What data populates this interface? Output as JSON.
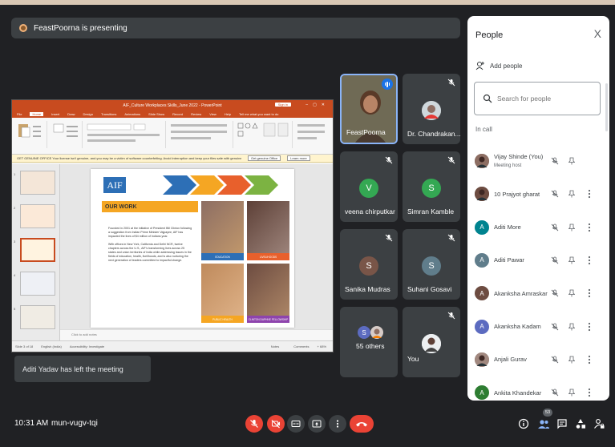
{
  "presenting_banner": "FeastPoorna is presenting",
  "shared_screen": {
    "title_bar": "AIF_Culture Workplaces Skills_June 2022 - PowerPoint",
    "sign_in": "Sign in",
    "menu": [
      "File",
      "Home",
      "Insert",
      "Draw",
      "Design",
      "Transitions",
      "Animations",
      "Slide Show",
      "Record",
      "Review",
      "View",
      "Help",
      "Tell me what you want to do"
    ],
    "warning": "GET GENUINE OFFICE  Your license isn't genuine, and you may be a victim of software counterfeiting. Avoid interruption and keep your files safe with genuine Office today.",
    "warning_btn1": "Get genuine Office",
    "warning_btn2": "Learn more",
    "slide": {
      "logo": "AIF",
      "heading": "OUR WORK",
      "para1": "Founded in 2001 at the initiative of President Bill Clinton following a suggestion from Indian Prime Minister Vajpayee, AIF has impacted the lives of $4 million of Indians year.",
      "para2": "With offices in New York, California and Delhi NCR, twelve chapters across the U.S., AIF's transforming lives across 25 states and union territories of India while addressing issues in the fields of education, health, livelihoods, and is also nurturing the next generation of leaders committed to impactful change.",
      "photo_captions": [
        "EDUCATION",
        "LIVELIHOODS",
        "PUBLIC HEALTH",
        "CLINTON DAPHNE FELLOWSHIP"
      ]
    },
    "notes": "Click to add notes",
    "status_left": "Slide 3 of 18",
    "status_lang": "English (India)",
    "status_access": "Accessibility: Investigate",
    "status_notes": "Notes",
    "status_comments": "Comments",
    "zoom": "+ 68%"
  },
  "toast": "Aditi Yadav has left the meeting",
  "tiles": [
    {
      "name": "FeastPoorna",
      "initial": "",
      "color": "",
      "muted": false
    },
    {
      "name": "Dr. Chandrakan...",
      "initial": "",
      "color": "",
      "muted": true
    },
    {
      "name": "veena chirputkar",
      "initial": "V",
      "color": "#34a853",
      "muted": true
    },
    {
      "name": "Simran Kamble",
      "initial": "S",
      "color": "#34a853",
      "muted": true
    },
    {
      "name": "Sanika Mudras",
      "initial": "S",
      "color": "#795548",
      "muted": true
    },
    {
      "name": "Suhani Gosavi",
      "initial": "S",
      "color": "#607d8b",
      "muted": true
    },
    {
      "name": "55 others",
      "initial": "S",
      "color": "#5c6bc0",
      "muted": false
    },
    {
      "name": "You",
      "initial": "",
      "color": "",
      "muted": true
    }
  ],
  "people_panel": {
    "title": "People",
    "close": "X",
    "add_people": "Add people",
    "search_placeholder": "Search for people",
    "in_call": "In call",
    "participants": [
      {
        "name": "Vijay Shinde (You)",
        "sub": "Meeting host",
        "initial": "",
        "color": "#8d6e63"
      },
      {
        "name": "10 Prajyot gharat",
        "sub": "",
        "initial": "",
        "color": "#6d4c41"
      },
      {
        "name": "Aditi More",
        "sub": "",
        "initial": "A",
        "color": "#00838f"
      },
      {
        "name": "Aditi Pawar",
        "sub": "",
        "initial": "A",
        "color": "#607d8b"
      },
      {
        "name": "Akanksha Amraskar",
        "sub": "",
        "initial": "A",
        "color": "#6d4c41"
      },
      {
        "name": "Akanksha Kadam",
        "sub": "",
        "initial": "A",
        "color": "#5c6bc0"
      },
      {
        "name": "Anjali Gurav",
        "sub": "",
        "initial": "",
        "color": "#a1887f"
      },
      {
        "name": "Ankita Khandekar",
        "sub": "",
        "initial": "A",
        "color": "#2e7d32"
      }
    ]
  },
  "bottom": {
    "time": "10:31 AM",
    "meeting_code": "mun-vugv-tqi",
    "people_count": "53"
  }
}
